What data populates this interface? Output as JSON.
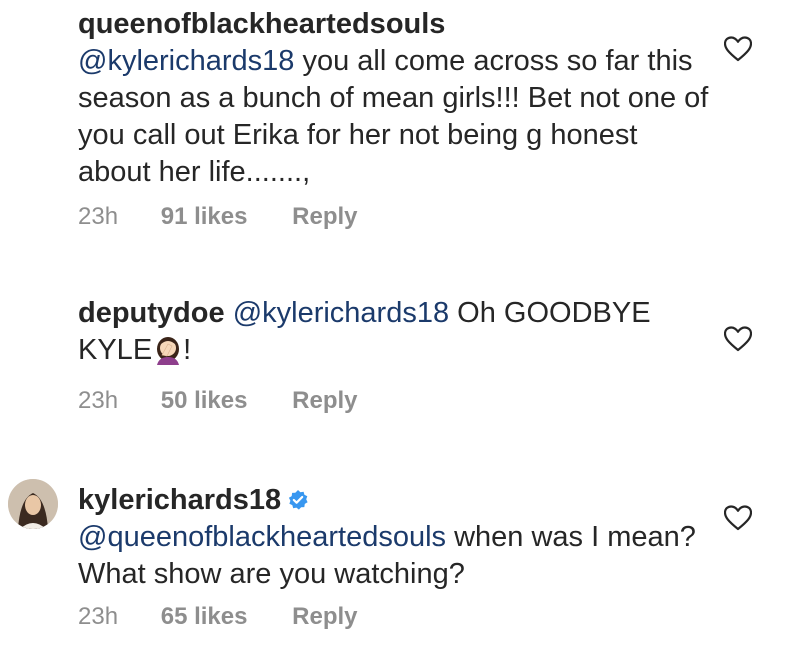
{
  "comments": [
    {
      "username": "queenofblackheartedsouls",
      "mention": "@kylerichards18",
      "text_after_mention": " you all come across so far this  season as a bunch of mean girls!!! Bet not one of you call out Erika for her not being g honest about her life.......,",
      "time": "23h",
      "likes": "91 likes",
      "reply": "Reply",
      "heart_icon": "heart-outline-icon"
    },
    {
      "username": "deputydoe",
      "mention": "@kylerichards18",
      "text_after_mention": " Oh GOODBYE KYLE",
      "emoji": "woman-facepalming-emoji",
      "text_end": "!",
      "time": "23h",
      "likes": "50 likes",
      "reply": "Reply",
      "heart_icon": "heart-outline-icon"
    },
    {
      "username": "kylerichards18",
      "verified": "verified-badge-icon",
      "mention": "@queenofblackheartedsouls",
      "text_after_mention": " when was I mean? What show are you watching?",
      "time": "23h",
      "likes": "65 likes",
      "reply": "Reply",
      "heart_icon": "heart-outline-icon",
      "avatar": "profile-avatar"
    }
  ],
  "colors": {
    "text": "#262626",
    "mention": "#1b3a6b",
    "meta": "#8e8e8e",
    "verified": "#3897f0"
  }
}
